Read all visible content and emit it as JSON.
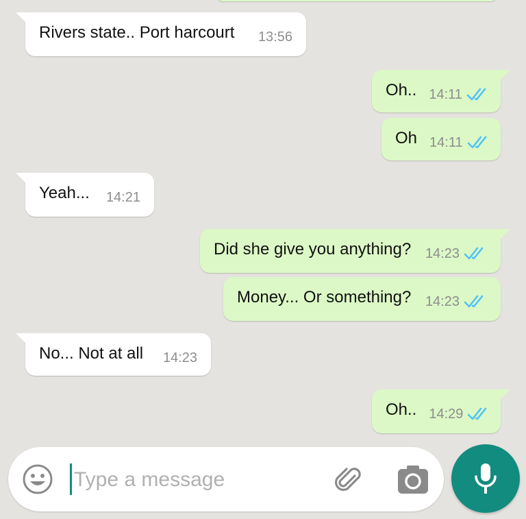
{
  "messages": [
    {
      "direction": "in",
      "text": "Rivers state.. Port harcourt",
      "time": "13:56"
    },
    {
      "direction": "out",
      "text": "Oh..",
      "time": "14:11",
      "status": "read"
    },
    {
      "direction": "out",
      "text": "Oh",
      "time": "14:11",
      "status": "read"
    },
    {
      "direction": "in",
      "text": "Yeah...",
      "time": "14:21"
    },
    {
      "direction": "out",
      "text": "Did she give you anything?",
      "time": "14:23",
      "status": "read"
    },
    {
      "direction": "out",
      "text": "Money... Or something?",
      "time": "14:23",
      "status": "read"
    },
    {
      "direction": "in",
      "text": "No... Not at all",
      "time": "14:23"
    },
    {
      "direction": "out",
      "text": "Oh..",
      "time": "14:29",
      "status": "read"
    }
  ],
  "composer": {
    "placeholder": "Type a message",
    "emoji_icon": "emoji-icon",
    "attach_icon": "paperclip-icon",
    "camera_icon": "camera-icon",
    "mic_icon": "microphone-icon"
  },
  "colors": {
    "background": "#e5e3df",
    "incoming_bubble": "#ffffff",
    "outgoing_bubble": "#dcf8c6",
    "read_ticks": "#4fc3f7",
    "accent": "#128c7e"
  }
}
